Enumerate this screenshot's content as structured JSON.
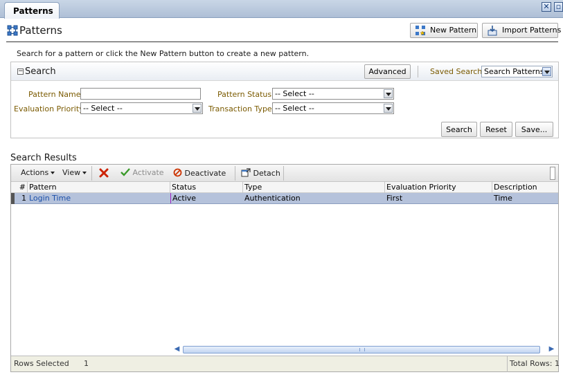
{
  "tab": {
    "label": "Patterns"
  },
  "header": {
    "title": "Patterns",
    "new_pattern_label": "New Pattern",
    "import_patterns_label": "Import Patterns"
  },
  "instruction": "Search for a pattern or click the New Pattern button to create a new pattern.",
  "search": {
    "title": "Search",
    "advanced_label": "Advanced",
    "saved_search_label": "Saved Search",
    "saved_search_value": "Search Patterns",
    "fields": {
      "pattern_name_label": "Pattern Name",
      "pattern_name_value": "",
      "pattern_status_label": "Pattern Status",
      "pattern_status_value": "-- Select --",
      "evaluation_priority_label": "Evaluation Priority",
      "evaluation_priority_value": "-- Select --",
      "transaction_type_label": "Transaction Type",
      "transaction_type_value": "-- Select --"
    },
    "buttons": {
      "search": "Search",
      "reset": "Reset",
      "save": "Save..."
    }
  },
  "results": {
    "title": "Search Results",
    "toolbar": {
      "actions": "Actions",
      "view": "View",
      "activate": "Activate",
      "deactivate": "Deactivate",
      "detach": "Detach"
    },
    "columns": [
      "#",
      "Pattern",
      "Status",
      "Type",
      "Evaluation Priority",
      "Description"
    ],
    "rows": [
      {
        "num": "1",
        "pattern": "Login Time",
        "status": "Active",
        "type": "Authentication",
        "priority": "First",
        "description": "Time"
      }
    ],
    "footer": {
      "rows_selected_label": "Rows Selected",
      "rows_selected_value": "1",
      "total_rows": "Total Rows: 1"
    }
  },
  "colors": {
    "link": "#1b4fa8",
    "label": "#7a5a00",
    "selected_row": "#b5c2db",
    "delete_red": "#cc2200",
    "activate_green": "#3a9a2a"
  }
}
